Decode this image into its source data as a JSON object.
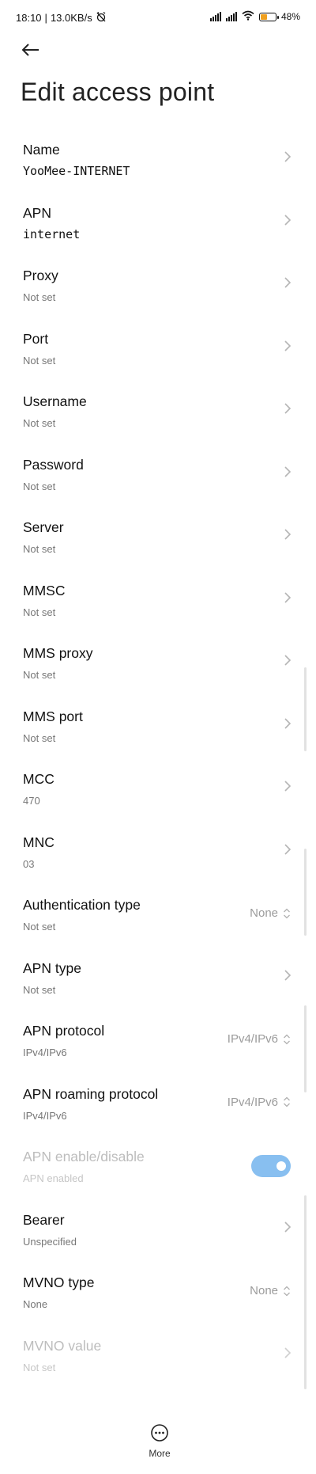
{
  "status": {
    "time": "18:10",
    "speed": "13.0KB/s",
    "battery": "48",
    "battery_level": 0.48
  },
  "title": "Edit access point",
  "rows": [
    {
      "label": "Name",
      "value": "YooMee-INTERNET",
      "control": "chevron",
      "mono": true
    },
    {
      "label": "APN",
      "value": "internet",
      "control": "chevron",
      "mono": true
    },
    {
      "label": "Proxy",
      "value": "Not set",
      "control": "chevron"
    },
    {
      "label": "Port",
      "value": "Not set",
      "control": "chevron"
    },
    {
      "label": "Username",
      "value": "Not set",
      "control": "chevron"
    },
    {
      "label": "Password",
      "value": "Not set",
      "control": "chevron"
    },
    {
      "label": "Server",
      "value": "Not set",
      "control": "chevron"
    },
    {
      "label": "MMSC",
      "value": "Not set",
      "control": "chevron"
    },
    {
      "label": "MMS proxy",
      "value": "Not set",
      "control": "chevron"
    },
    {
      "label": "MMS port",
      "value": "Not set",
      "control": "chevron"
    },
    {
      "label": "MCC",
      "value": "470",
      "control": "chevron"
    },
    {
      "label": "MNC",
      "value": "03",
      "control": "chevron"
    },
    {
      "label": "Authentication type",
      "value": "Not set",
      "control": "select",
      "selected": "None"
    },
    {
      "label": "APN type",
      "value": "Not set",
      "control": "chevron"
    },
    {
      "label": "APN protocol",
      "value": "IPv4/IPv6",
      "control": "select",
      "selected": "IPv4/IPv6"
    },
    {
      "label": "APN roaming protocol",
      "value": "IPv4/IPv6",
      "control": "select",
      "selected": "IPv4/IPv6"
    },
    {
      "label": "APN enable/disable",
      "value": "APN enabled",
      "control": "toggle",
      "disabled": true,
      "toggle_on": true
    },
    {
      "label": "Bearer",
      "value": "Unspecified",
      "control": "chevron"
    },
    {
      "label": "MVNO type",
      "value": "None",
      "control": "select",
      "selected": "None"
    },
    {
      "label": "MVNO value",
      "value": "Not set",
      "control": "chevron",
      "disabled": true
    }
  ],
  "more_label": "More"
}
